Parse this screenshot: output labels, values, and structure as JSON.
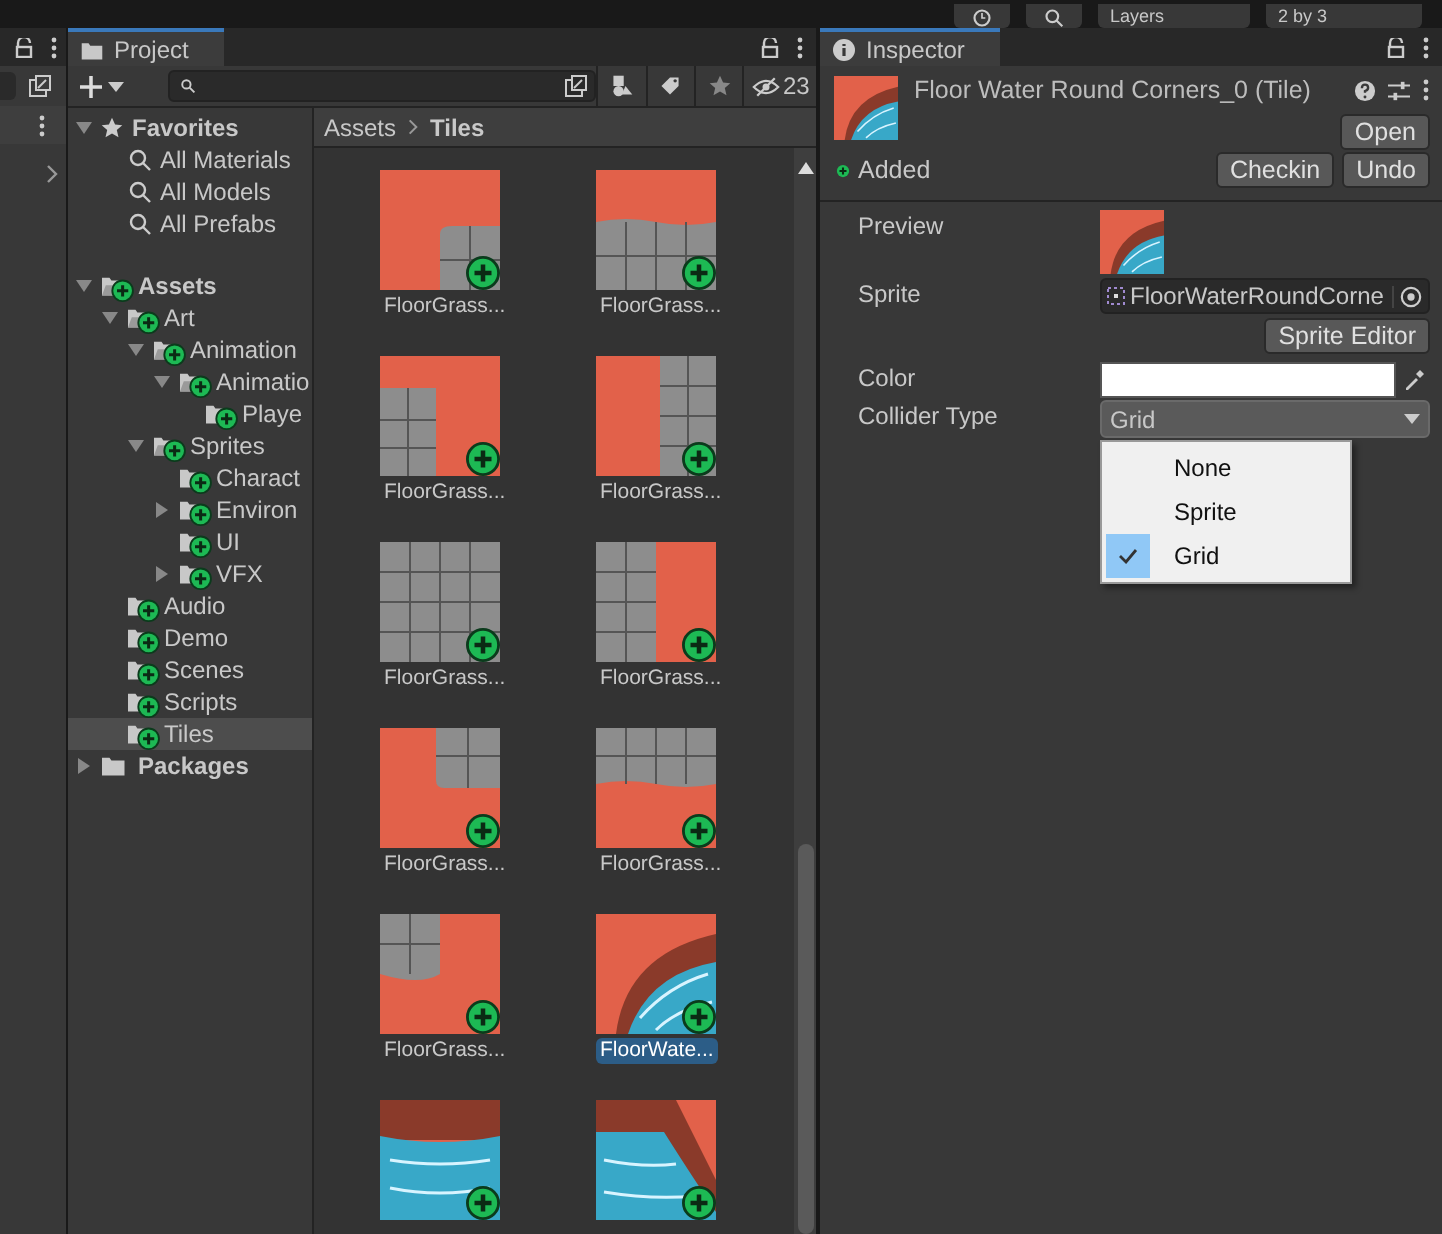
{
  "toolbar": {
    "layers": "Layers",
    "layout": "2 by 3"
  },
  "project": {
    "tab": "Project",
    "hidden_count": "23",
    "favorites": {
      "label": "Favorites",
      "expanded": true,
      "items": [
        "All Materials",
        "All Models",
        "All Prefabs"
      ]
    },
    "tree": [
      {
        "label": "Assets",
        "expanded": true,
        "selected": false,
        "children": [
          {
            "label": "Art",
            "expanded": true,
            "selected": false,
            "children": [
              {
                "label": "Animation",
                "expanded": true,
                "selected": false,
                "children": [
                  {
                    "label": "Animatio",
                    "expanded": true,
                    "selected": false,
                    "children": [
                      {
                        "label": "Playe",
                        "selected": false
                      }
                    ]
                  }
                ]
              },
              {
                "label": "Sprites",
                "expanded": true,
                "selected": false,
                "children": [
                  {
                    "label": "Charact",
                    "selected": false
                  },
                  {
                    "label": "Environ",
                    "expanded": false,
                    "selected": false
                  },
                  {
                    "label": "UI",
                    "selected": false
                  },
                  {
                    "label": "VFX",
                    "expanded": false,
                    "selected": false
                  }
                ]
              }
            ]
          },
          {
            "label": "Audio",
            "selected": false
          },
          {
            "label": "Demo",
            "selected": false
          },
          {
            "label": "Scenes",
            "selected": false
          },
          {
            "label": "Scripts",
            "selected": false
          },
          {
            "label": "Tiles",
            "selected": true
          }
        ]
      },
      {
        "label": "Packages",
        "expanded": false,
        "selected": false
      }
    ],
    "breadcrumb": [
      "Assets",
      "Tiles"
    ],
    "tiles": [
      {
        "label": "FloorGrass...",
        "selected": false
      },
      {
        "label": "FloorGrass...",
        "selected": false
      },
      {
        "label": "FloorGrass...",
        "selected": false
      },
      {
        "label": "FloorGrass...",
        "selected": false
      },
      {
        "label": "FloorGrass...",
        "selected": false
      },
      {
        "label": "FloorGrass...",
        "selected": false
      },
      {
        "label": "FloorGrass...",
        "selected": false
      },
      {
        "label": "FloorGrass...",
        "selected": false
      },
      {
        "label": "FloorGrass...",
        "selected": false
      },
      {
        "label": "FloorWate...",
        "selected": true
      },
      {
        "selected": false
      },
      {
        "selected": false
      }
    ]
  },
  "inspector": {
    "tab": "Inspector",
    "title": "Floor Water Round Corners_0 (Tile)",
    "status": "Added",
    "buttons": {
      "open": "Open",
      "checkin": "Checkin",
      "undo": "Undo"
    },
    "fields": [
      {
        "kind": "preview",
        "label": "Preview"
      },
      {
        "kind": "object",
        "label": "Sprite",
        "value": "FloorWaterRoundCorne",
        "button": "Sprite Editor"
      },
      {
        "kind": "color",
        "label": "Color",
        "color": "#ffffff"
      },
      {
        "kind": "dropdown",
        "label": "Collider Type",
        "value": "Grid",
        "expanded": true,
        "options": [
          {
            "label": "None",
            "selected": false
          },
          {
            "label": "Sprite",
            "selected": false
          },
          {
            "label": "Grid",
            "selected": true
          }
        ]
      }
    ]
  }
}
